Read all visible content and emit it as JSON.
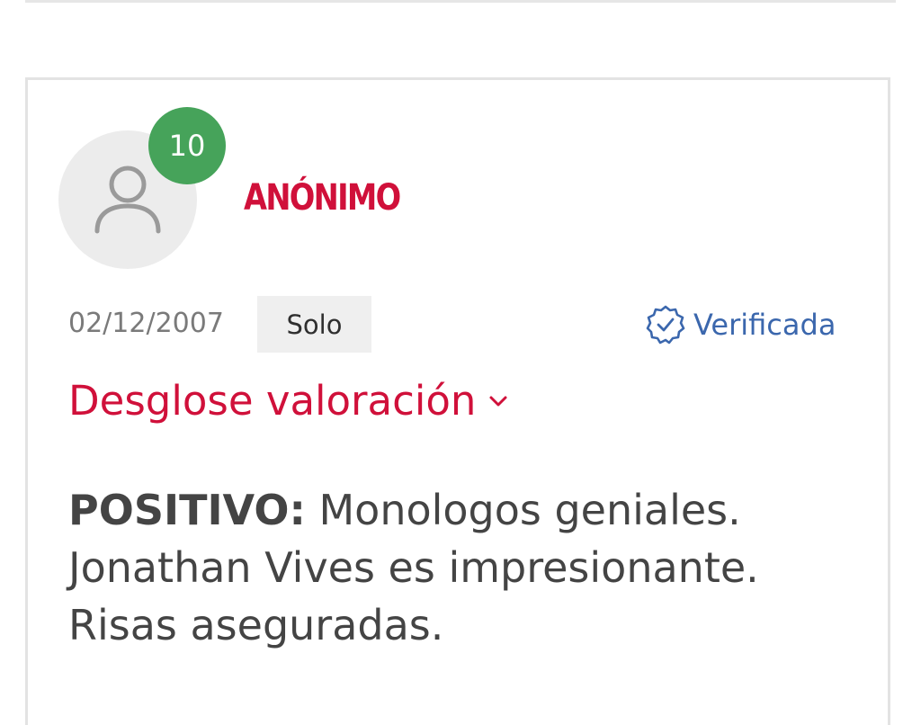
{
  "review": {
    "score": "10",
    "reviewer_name": "ANÓNIMO",
    "date": "02/12/2007",
    "travel_type": "Solo",
    "verified_label": "Verificada",
    "breakdown_label": "Desglose valoración",
    "positive_label": "POSITIVO:",
    "positive_text": "Monologos geniales. Jonathan Vives es impresionante. Risas aseguradas."
  },
  "icons": {
    "avatar": "user-icon",
    "verified": "verified-badge-icon",
    "breakdown": "chevron-down-icon"
  },
  "colors": {
    "accent_red": "#d0103a",
    "score_green": "#46a35a",
    "verified_blue": "#3b67ad"
  }
}
